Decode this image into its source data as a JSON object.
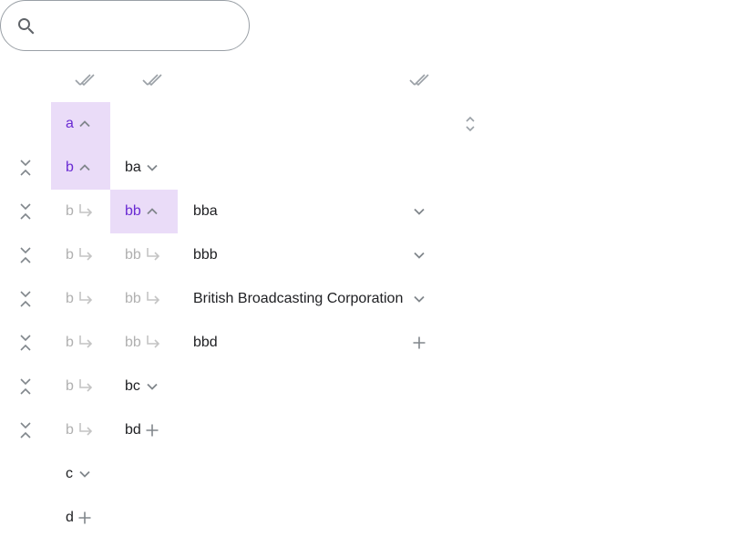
{
  "search": {
    "placeholder": "",
    "value": ""
  },
  "header": {
    "icons": [
      "check-all-icon",
      "check-all-icon",
      "check-all-icon"
    ],
    "sort_icon": "unfold-icon"
  },
  "columns": {
    "col1": [
      {
        "label": "a",
        "state": "selected",
        "icon": "chevron-up-icon"
      },
      {
        "label": "b",
        "state": "selected",
        "icon": "chevron-up-icon"
      },
      {
        "label": "b",
        "state": "muted",
        "icon": "subdirectory-arrow-icon"
      },
      {
        "label": "b",
        "state": "muted",
        "icon": "subdirectory-arrow-icon"
      },
      {
        "label": "b",
        "state": "muted",
        "icon": "subdirectory-arrow-icon"
      },
      {
        "label": "b",
        "state": "muted",
        "icon": "subdirectory-arrow-icon"
      },
      {
        "label": "b",
        "state": "muted",
        "icon": "subdirectory-arrow-icon"
      },
      {
        "label": "b",
        "state": "muted",
        "icon": "subdirectory-arrow-icon"
      },
      {
        "label": "c",
        "state": "normal",
        "icon": "chevron-down-icon"
      },
      {
        "label": "d",
        "state": "normal",
        "icon": "plus-icon"
      }
    ],
    "col2": [
      {
        "label": "ba",
        "state": "normal",
        "icon": "chevron-down-icon"
      },
      {
        "label": "bb",
        "state": "selected",
        "icon": "chevron-up-icon"
      },
      {
        "label": "bb",
        "state": "muted",
        "icon": "subdirectory-arrow-icon"
      },
      {
        "label": "bb",
        "state": "muted",
        "icon": "subdirectory-arrow-icon"
      },
      {
        "label": "bb",
        "state": "muted",
        "icon": "subdirectory-arrow-icon"
      },
      {
        "label": "bc",
        "state": "normal",
        "icon": "chevron-down-icon"
      },
      {
        "label": "bd",
        "state": "normal",
        "icon": "plus-icon"
      }
    ],
    "col3": [
      {
        "label": "bba",
        "icon": "chevron-down-icon"
      },
      {
        "label": "bbb",
        "icon": "chevron-down-icon"
      },
      {
        "label": "British Broadcasting Corporation",
        "icon": "chevron-down-icon"
      },
      {
        "label": "bbd",
        "icon": "plus-icon"
      }
    ]
  },
  "collapse_icon": "collapse-vertical-icon"
}
